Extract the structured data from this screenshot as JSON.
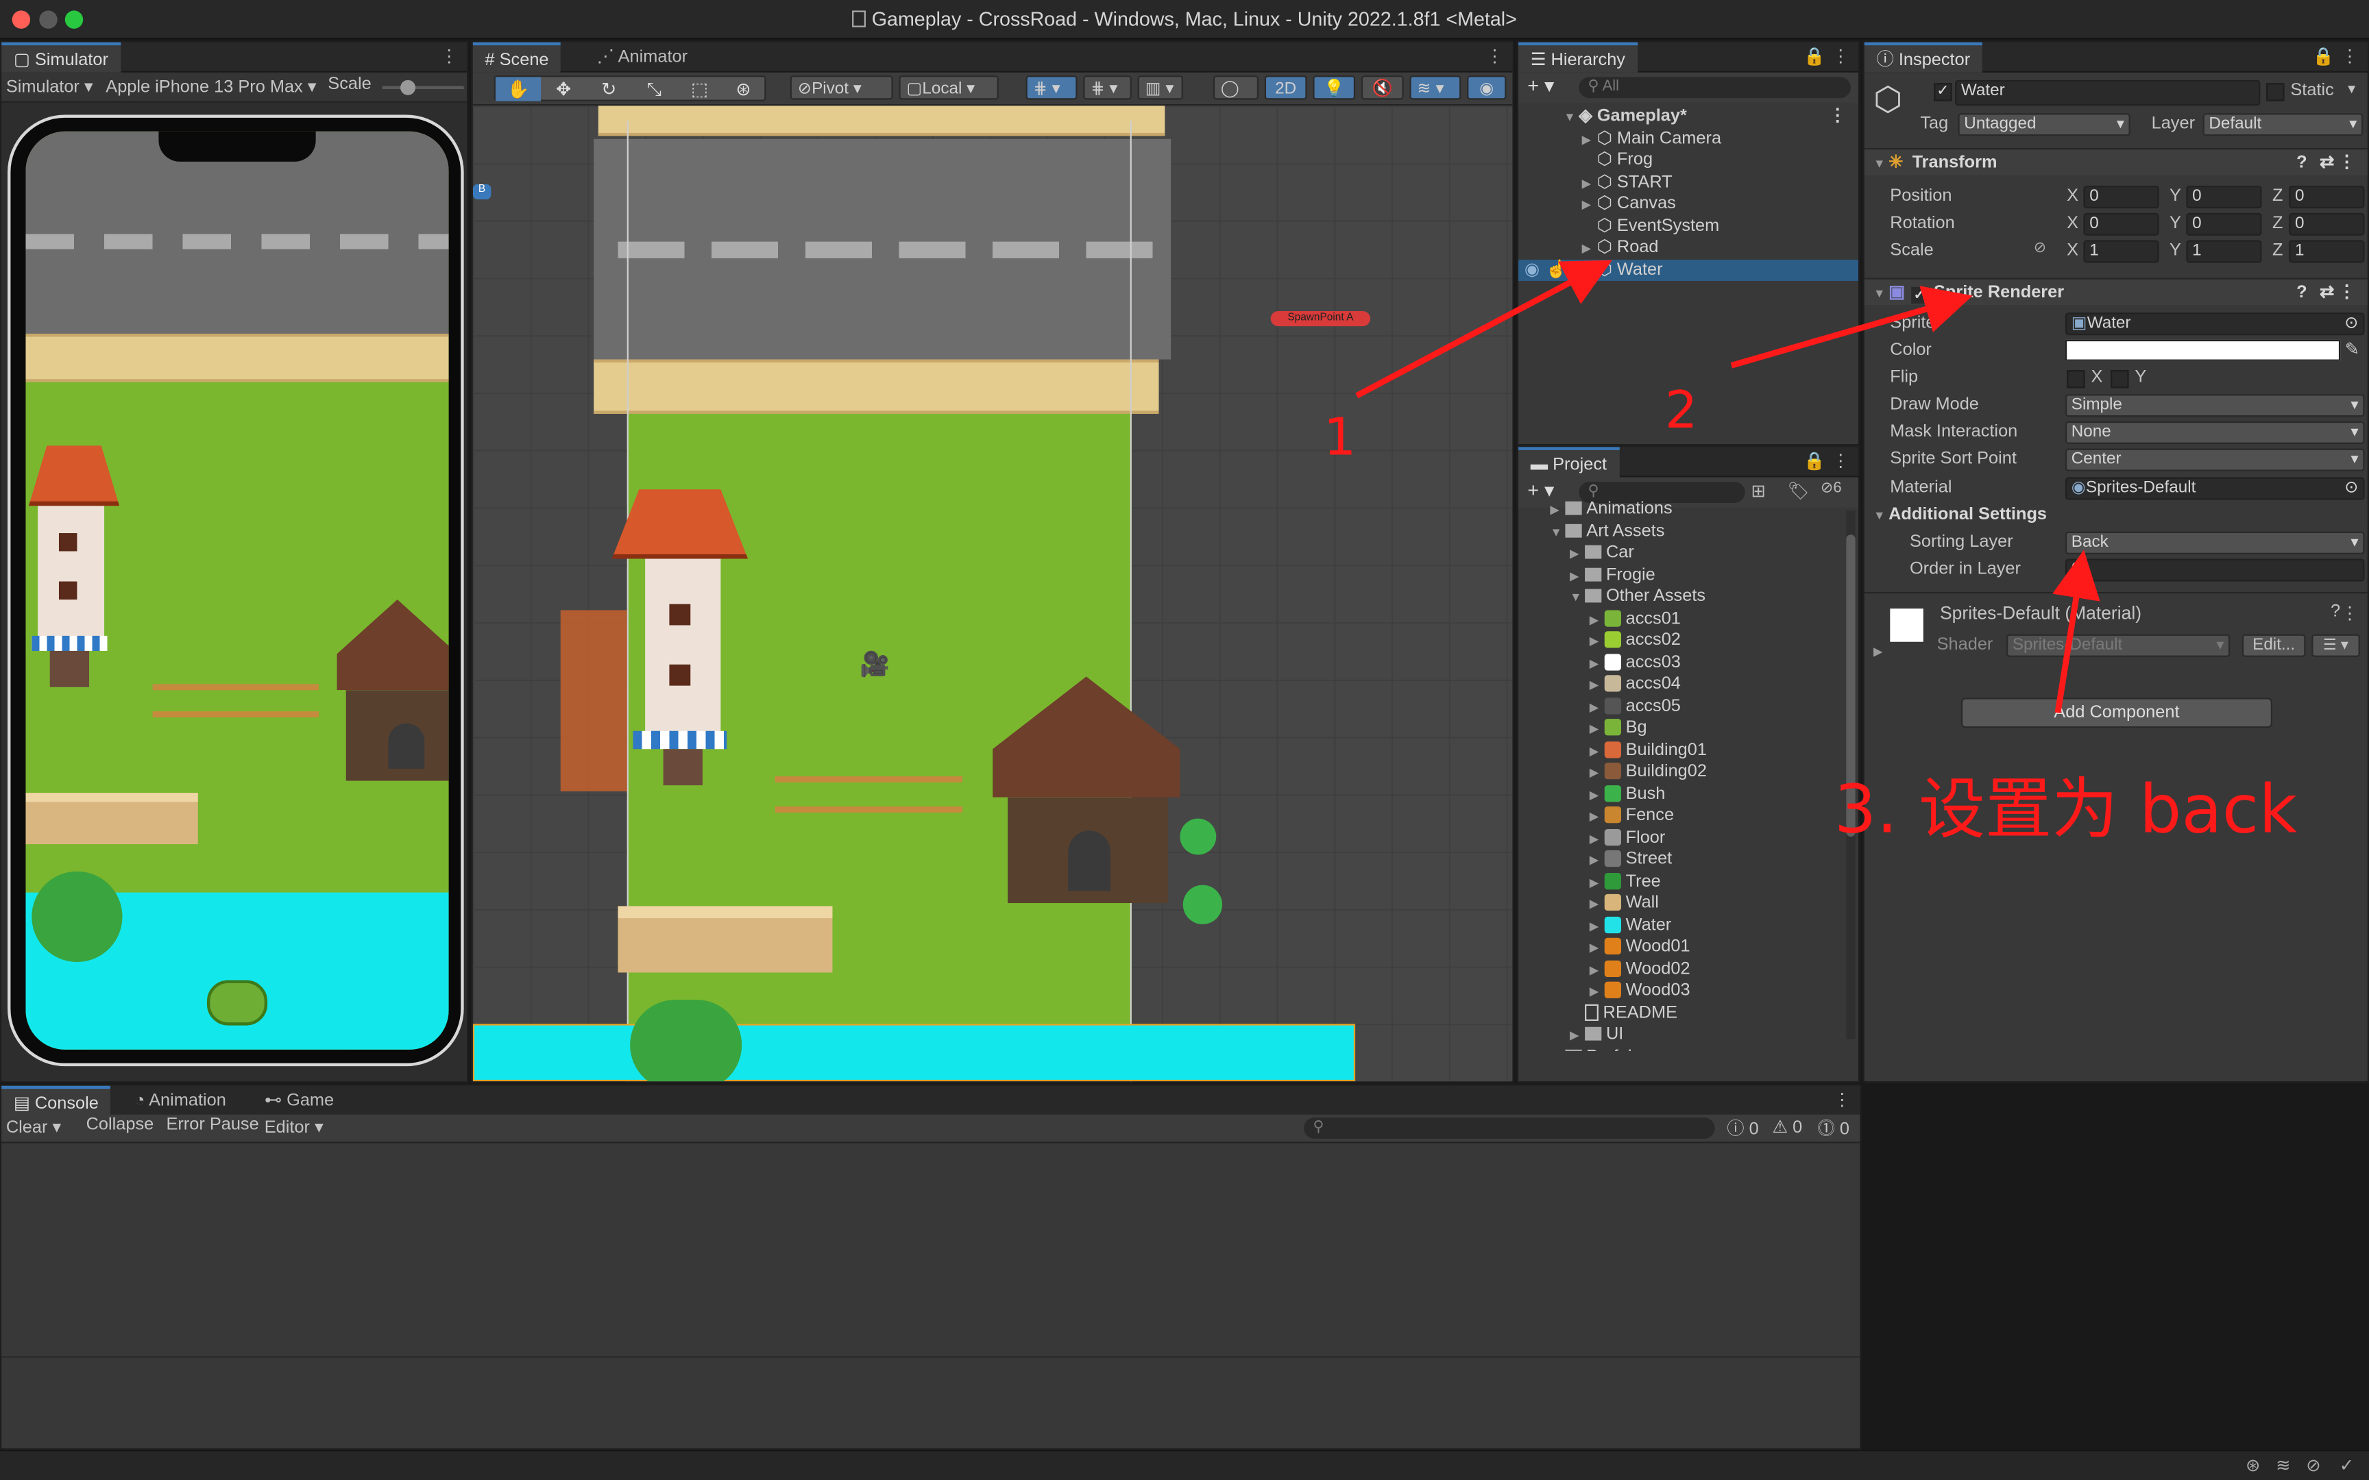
{
  "window": {
    "title": "Gameplay - CrossRoad - Windows, Mac, Linux - Unity 2022.1.8f1 <Metal>"
  },
  "simulator": {
    "tab": "Simulator",
    "mode": "Simulator",
    "device": "Apple iPhone 13 Pro Max",
    "scale_label": "Scale"
  },
  "scene": {
    "tabs": [
      "Scene",
      "Animator"
    ],
    "pivot": "Pivot",
    "local": "Local",
    "mode_2d": "2D",
    "spawn_label": "SpawnPoint A"
  },
  "hierarchy": {
    "tab": "Hierarchy",
    "search_placeholder": "All",
    "root": "Gameplay*",
    "items": [
      "Main Camera",
      "Frog",
      "START",
      "Canvas",
      "EventSystem",
      "Road",
      "Water"
    ],
    "selected": "Water"
  },
  "project": {
    "tab": "Project",
    "hidden_count": "6",
    "items": [
      {
        "label": "Animations",
        "kind": "folder",
        "depth": 1,
        "expanded": false
      },
      {
        "label": "Art Assets",
        "kind": "folder",
        "depth": 1,
        "expanded": true
      },
      {
        "label": "Car",
        "kind": "folder",
        "depth": 2,
        "expanded": false
      },
      {
        "label": "Frogie",
        "kind": "folder",
        "depth": 2,
        "expanded": false
      },
      {
        "label": "Other Assets",
        "kind": "folder",
        "depth": 2,
        "expanded": true
      },
      {
        "label": "accs01",
        "kind": "asset",
        "depth": 3,
        "color": "#7ab53a"
      },
      {
        "label": "accs02",
        "kind": "asset",
        "depth": 3,
        "color": "#9acd32"
      },
      {
        "label": "accs03",
        "kind": "asset",
        "depth": 3,
        "color": "#ffffff"
      },
      {
        "label": "accs04",
        "kind": "asset",
        "depth": 3,
        "color": "#c8b89a"
      },
      {
        "label": "accs05",
        "kind": "asset",
        "depth": 3,
        "color": "#555555"
      },
      {
        "label": "Bg",
        "kind": "asset",
        "depth": 3,
        "color": "#7ab53a"
      },
      {
        "label": "Building01",
        "kind": "asset",
        "depth": 3,
        "color": "#d9683a"
      },
      {
        "label": "Building02",
        "kind": "asset",
        "depth": 3,
        "color": "#8a5a3a"
      },
      {
        "label": "Bush",
        "kind": "asset",
        "depth": 3,
        "color": "#3bb34a"
      },
      {
        "label": "Fence",
        "kind": "asset",
        "depth": 3,
        "color": "#c9862e"
      },
      {
        "label": "Floor",
        "kind": "asset",
        "depth": 3,
        "color": "#9a9a9a"
      },
      {
        "label": "Street",
        "kind": "asset",
        "depth": 3,
        "color": "#777777"
      },
      {
        "label": "Tree",
        "kind": "asset",
        "depth": 3,
        "color": "#2f9a3a"
      },
      {
        "label": "Wall",
        "kind": "asset",
        "depth": 3,
        "color": "#d8b57a"
      },
      {
        "label": "Water",
        "kind": "asset",
        "depth": 3,
        "color": "#22e2e8"
      },
      {
        "label": "Wood01",
        "kind": "asset",
        "depth": 3,
        "color": "#e0801a"
      },
      {
        "label": "Wood02",
        "kind": "asset",
        "depth": 3,
        "color": "#e0801a"
      },
      {
        "label": "Wood03",
        "kind": "asset",
        "depth": 3,
        "color": "#e0801a"
      },
      {
        "label": "README",
        "kind": "doc",
        "depth": 2
      },
      {
        "label": "UI",
        "kind": "folder",
        "depth": 2,
        "expanded": false
      },
      {
        "label": "Prefabs",
        "kind": "folder",
        "depth": 1,
        "expanded": false
      }
    ]
  },
  "inspector": {
    "tab": "Inspector",
    "object_name": "Water",
    "static_label": "Static",
    "tag_label": "Tag",
    "tag_value": "Untagged",
    "layer_label": "Layer",
    "layer_value": "Default",
    "transform": {
      "title": "Transform",
      "rows": [
        {
          "label": "Position",
          "x": "0",
          "y": "0",
          "z": "0"
        },
        {
          "label": "Rotation",
          "x": "0",
          "y": "0",
          "z": "0"
        },
        {
          "label": "Scale",
          "x": "1",
          "y": "1",
          "z": "1"
        }
      ]
    },
    "sprite_renderer": {
      "title": "Sprite Renderer",
      "sprite_label": "Sprite",
      "sprite_value": "Water",
      "color_label": "Color",
      "flip_label": "Flip",
      "flip_x": "X",
      "flip_y": "Y",
      "draw_mode_label": "Draw Mode",
      "draw_mode_value": "Simple",
      "mask_label": "Mask Interaction",
      "mask_value": "None",
      "sort_point_label": "Sprite Sort Point",
      "sort_point_value": "Center",
      "material_label": "Material",
      "material_value": "Sprites-Default",
      "additional_label": "Additional Settings",
      "sorting_layer_label": "Sorting Layer",
      "sorting_layer_value": "Back",
      "order_label": "Order in Layer",
      "order_value": "0"
    },
    "material": {
      "title": "Sprites-Default (Material)",
      "shader_label": "Shader",
      "shader_value": "Sprites-Default",
      "edit_label": "Edit..."
    },
    "add_component": "Add Component"
  },
  "console": {
    "tabs": [
      "Console",
      "Animation",
      "Game"
    ],
    "clear": "Clear",
    "collapse": "Collapse",
    "error_pause": "Error Pause",
    "editor": "Editor",
    "log_count": "0",
    "warn_count": "0",
    "error_count": "0"
  },
  "annotations": {
    "step1": "1",
    "step2": "2",
    "step3": "3. 设置为 back",
    "color": "#ff1a1a"
  }
}
